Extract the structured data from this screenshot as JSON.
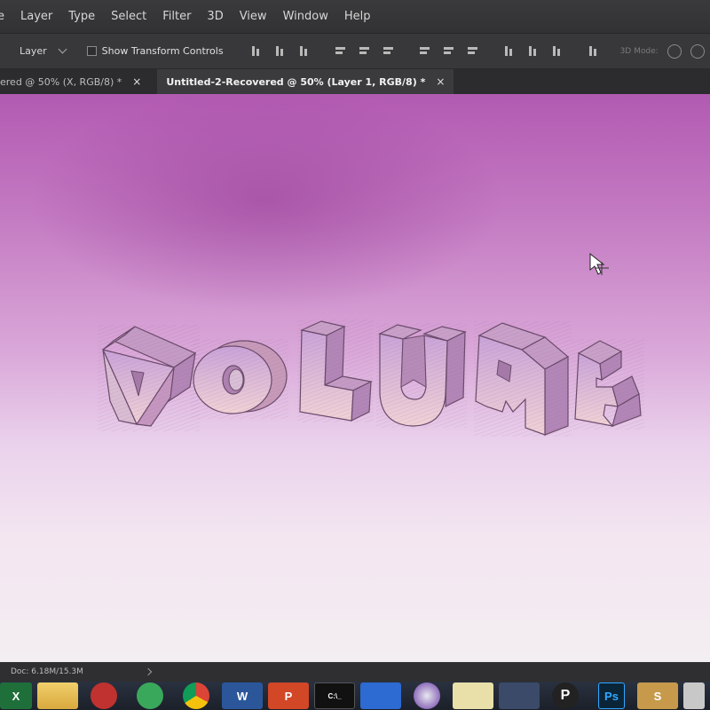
{
  "menu": [
    "e",
    "Layer",
    "Type",
    "Select",
    "Filter",
    "3D",
    "View",
    "Window",
    "Help"
  ],
  "options": {
    "layer_select": "Layer",
    "transform_controls": "Show Transform Controls",
    "mode_3d": "3D Mode:"
  },
  "tabs": [
    {
      "label": "ered @ 50% (X, RGB/8) *",
      "active": false,
      "close": "×"
    },
    {
      "label": "Untitled-2-Recovered @ 50% (Layer 1, RGB/8) *",
      "active": true,
      "close": "×"
    }
  ],
  "canvas": {
    "text": "VOLUME",
    "face_color": "#e6c7d6",
    "side_color": "#c79ab9",
    "outline_color": "#6a4a6a"
  },
  "status": {
    "doc_info": "Doc: 6.18M/15.3M"
  },
  "taskbar": {
    "apps": [
      {
        "name": "excel",
        "label": "X"
      },
      {
        "name": "folder",
        "label": ""
      },
      {
        "name": "red-app",
        "label": ""
      },
      {
        "name": "green-app",
        "label": ""
      },
      {
        "name": "chrome",
        "label": ""
      },
      {
        "name": "word",
        "label": "W"
      },
      {
        "name": "powerpoint",
        "label": "P"
      },
      {
        "name": "cmd",
        "label": "C:\\_"
      },
      {
        "name": "blue-app",
        "label": ""
      },
      {
        "name": "purple-app",
        "label": ""
      },
      {
        "name": "notes",
        "label": ""
      },
      {
        "name": "moon-app",
        "label": ""
      },
      {
        "name": "p-app",
        "label": "P"
      },
      {
        "name": "photoshop",
        "label": "Ps"
      },
      {
        "name": "s-app",
        "label": "S"
      },
      {
        "name": "other-app",
        "label": ""
      }
    ]
  }
}
